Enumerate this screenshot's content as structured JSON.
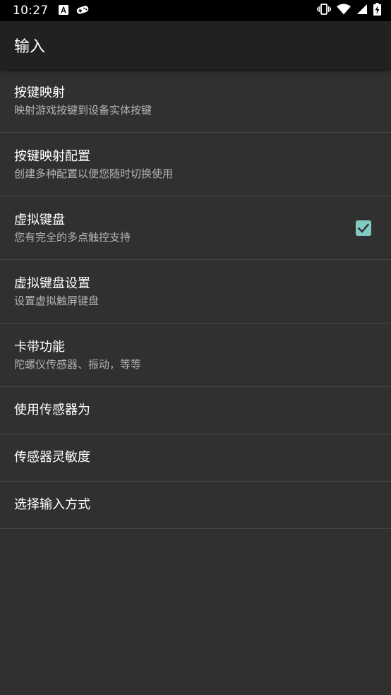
{
  "status_bar": {
    "time": "10:27",
    "left_icons": [
      "a-badge-icon",
      "game-controller-icon"
    ],
    "right_icons": [
      "vibrate-icon",
      "wifi-icon",
      "signal-icon",
      "battery-charging-icon"
    ]
  },
  "app_bar": {
    "title": "输入"
  },
  "preferences": [
    {
      "title": "按键映射",
      "summary": "映射游戏按键到设备实体按键"
    },
    {
      "title": "按键映射配置",
      "summary": "创建多种配置以便您随时切换使用"
    },
    {
      "title": "虚拟键盘",
      "summary": "您有完全的多点触控支持",
      "checked": true
    },
    {
      "title": "虚拟键盘设置",
      "summary": "设置虚拟触屏键盘"
    },
    {
      "title": "卡带功能",
      "summary": "陀螺仪传感器、振动，等等"
    },
    {
      "title": "使用传感器为"
    },
    {
      "title": "传感器灵敏度"
    },
    {
      "title": "选择输入方式"
    }
  ],
  "colors": {
    "background": "#303030",
    "app_bar": "#212121",
    "status_bar": "#000000",
    "accent": "#80cbc4",
    "divider": "#474747"
  }
}
